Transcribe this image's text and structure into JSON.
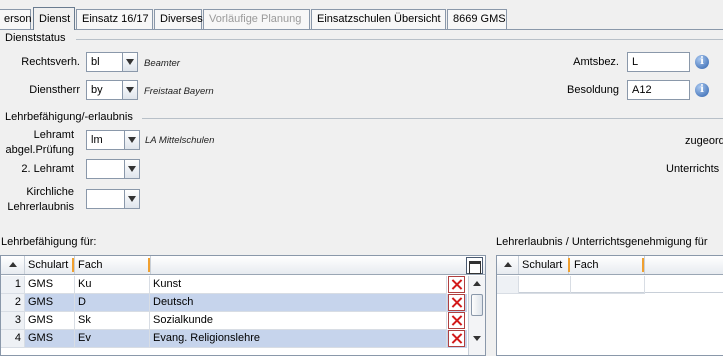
{
  "tabs": [
    {
      "label": "erson",
      "state": "normal"
    },
    {
      "label": "Dienst",
      "state": "active"
    },
    {
      "label": "Einsatz 16/17",
      "state": "normal"
    },
    {
      "label": "Diverses",
      "state": "normal"
    },
    {
      "label": "Vorläufige Planung",
      "state": "disabled"
    },
    {
      "label": "Einsatzschulen Übersicht",
      "state": "normal"
    },
    {
      "label": "8669 GMS",
      "state": "normal"
    }
  ],
  "dienststatus": {
    "heading": "Dienststatus",
    "rechtsverh": {
      "label": "Rechtsverh.",
      "value": "bl",
      "hint": "Beamter"
    },
    "dienstherr": {
      "label": "Dienstherr",
      "value": "by",
      "hint": "Freistaat Bayern"
    },
    "amtsbez": {
      "label": "Amtsbez.",
      "value": "L"
    },
    "besoldung": {
      "label": "Besoldung",
      "value": "A12"
    }
  },
  "lehrbefaehigung": {
    "heading": "Lehrbefähigung/-erlaubnis",
    "lehramt_label_1": "Lehramt",
    "lehramt_label_2": "abgel.Prüfung",
    "lehramt_value": "lm",
    "lehramt_hint": "LA Mittelschulen",
    "lehramt2_label": "2. Lehramt",
    "lehramt2_value": "",
    "kirchliche_label_1": "Kirchliche",
    "kirchliche_label_2": "Lehrerlaubnis",
    "kirchliche_value": "",
    "zugeordnet_label": "zugeord",
    "unterrichts_label": "Unterrichts"
  },
  "left_grid": {
    "title": "Lehrbefähigung für:",
    "columns": [
      "Schulart",
      "Fach"
    ],
    "rows": [
      {
        "num": "1",
        "schulart": "GMS",
        "code": "Ku",
        "fach": "Kunst",
        "selected": false
      },
      {
        "num": "2",
        "schulart": "GMS",
        "code": "D",
        "fach": "Deutsch",
        "selected": true
      },
      {
        "num": "3",
        "schulart": "GMS",
        "code": "Sk",
        "fach": "Sozialkunde",
        "selected": false
      },
      {
        "num": "4",
        "schulart": "GMS",
        "code": "Ev",
        "fach": "Evang. Religionslehre",
        "selected": true
      }
    ]
  },
  "right_grid": {
    "title": "Lehrerlaubnis / Unterrichtsgenehmigung für",
    "columns": [
      "Schulart",
      "Fach"
    ]
  },
  "icons": {
    "info": "info-icon",
    "delete": "delete-x-icon",
    "dropdown": "chevron-down-icon",
    "columns": "column-chooser-icon"
  },
  "colors": {
    "selected_row": "#c6d4ec",
    "accent_separator": "#f0a030",
    "info": "#2f62ad",
    "delete": "#d31a1a"
  }
}
